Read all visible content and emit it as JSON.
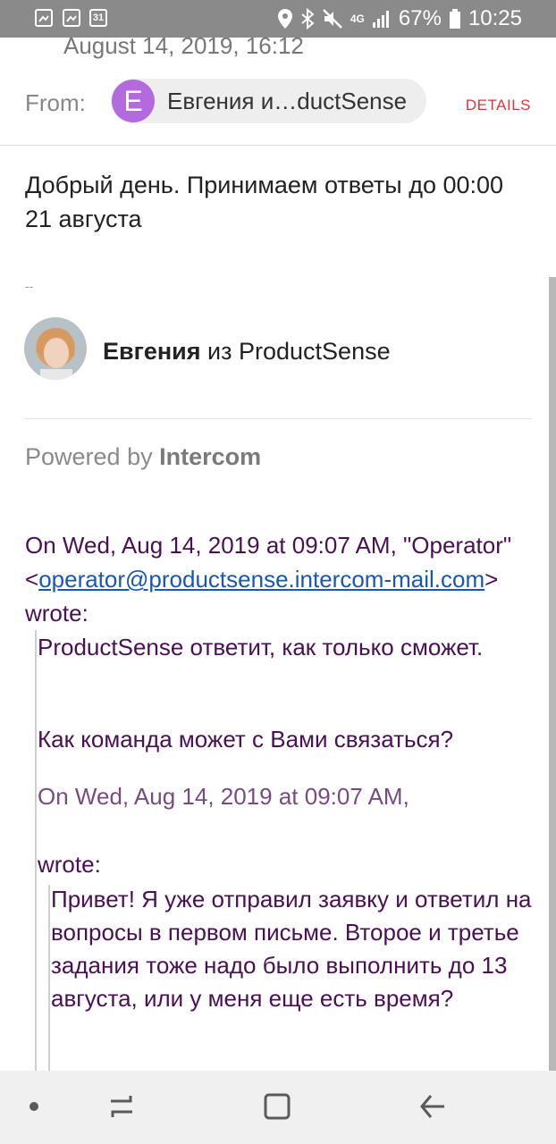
{
  "status_bar": {
    "calendar_day": "31",
    "network": "4G",
    "battery_percent": "67%",
    "time": "10:25"
  },
  "email": {
    "date": "August 14, 2019, 16:12",
    "from_label": "From:",
    "sender_initial": "E",
    "sender_chip": "Евгения и…ductSense",
    "details_label": "DETAILS",
    "body": "Добрый день. Принимаем ответы до 00:00 21 августа",
    "signature_dash": "--",
    "signature_name": "Евгения",
    "signature_rest": " из ProductSense",
    "powered_prefix": "Powered by ",
    "powered_brand": "Intercom",
    "quote_head_prefix": "On Wed, Aug 14, 2019 at 09:07 AM, \"Operator\" <",
    "quote_head_link": "operator@productsense.intercom-mail.com",
    "quote_head_suffix": "> wrote:",
    "quote1_line1": "ProductSense ответит, как только сможет.",
    "quote1_line2": "Как команда может с Вами связаться?",
    "quote1_line3": "On Wed, Aug 14, 2019 at 09:07 AM,",
    "quote1_wrote": "wrote:",
    "quote2_text": "Привет! Я уже отправил заявку и ответил на вопросы в первом письме. Второе и третье задания тоже надо было выполнить до 13 августа, или у меня еще есть время?"
  },
  "colors": {
    "status_bar": "#8a8a8a",
    "avatar_chip": "#b46adf",
    "details": "#d8383e",
    "quote_text": "#4b0f56",
    "link": "#1a57b5"
  }
}
